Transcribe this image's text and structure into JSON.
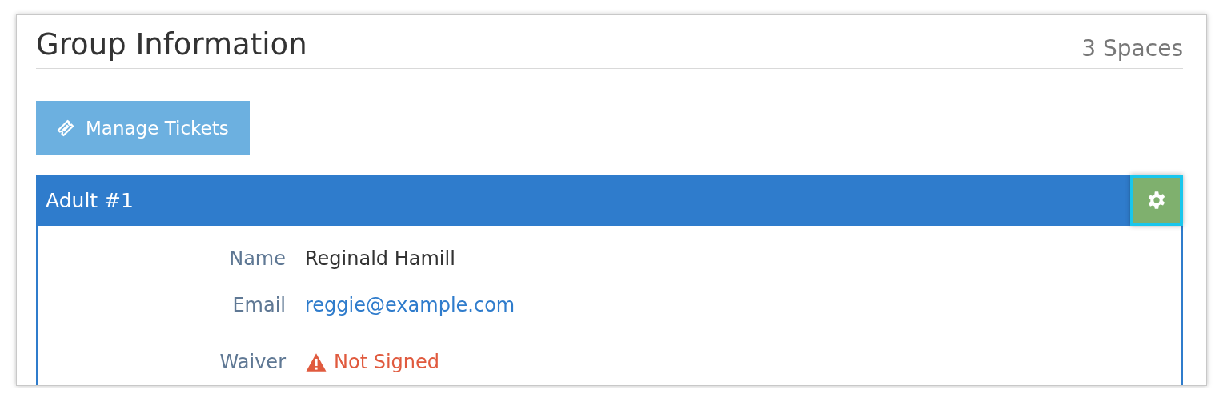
{
  "header": {
    "title": "Group Information",
    "spaces": "3 Spaces"
  },
  "manage_button": {
    "label": "Manage Tickets"
  },
  "card": {
    "title": "Adult #1",
    "settings_button": {
      "highlighted": true
    },
    "sections": [
      [
        {
          "label": "Name",
          "value": "Reginald Hamill",
          "kind": "text"
        },
        {
          "label": "Email",
          "value": "reggie@example.com",
          "kind": "link"
        }
      ],
      [
        {
          "label": "Waiver",
          "value": "Not Signed",
          "kind": "warning"
        }
      ]
    ]
  }
}
